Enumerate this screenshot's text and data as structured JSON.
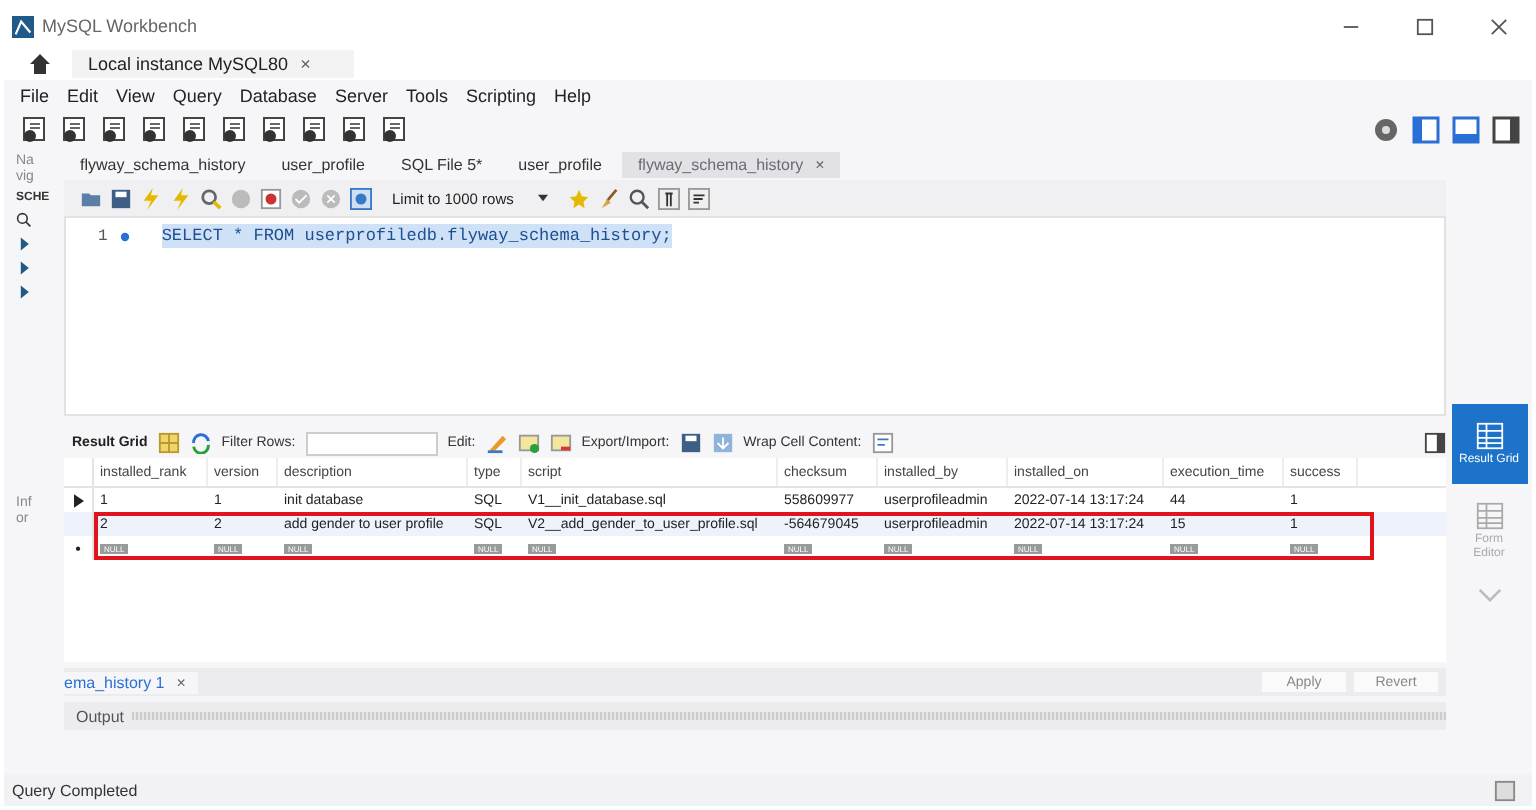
{
  "window": {
    "title": "MySQL Workbench"
  },
  "connection_tab": {
    "label": "Local instance MySQL80",
    "close": "×"
  },
  "menu": [
    "File",
    "Edit",
    "View",
    "Query",
    "Database",
    "Server",
    "Tools",
    "Scripting",
    "Help"
  ],
  "navigator": {
    "label": "Na vig",
    "schemas_label": "SCHE",
    "info_label": "Inf or"
  },
  "editor_tabs": [
    {
      "label": "flyway_schema_history",
      "selected": false
    },
    {
      "label": "user_profile",
      "selected": false
    },
    {
      "label": "SQL File 5*",
      "selected": false
    },
    {
      "label": "user_profile",
      "selected": false
    },
    {
      "label": "flyway_schema_history",
      "selected": true,
      "close": "×"
    }
  ],
  "editor_toolbar": {
    "limit": "Limit to 1000 rows"
  },
  "editor": {
    "lines": [
      {
        "number": "1",
        "text": "SELECT * FROM userprofiledb.flyway_schema_history;",
        "selected": true
      }
    ]
  },
  "result_toolbar": {
    "result_grid": "Result Grid",
    "filter_label": "Filter Rows:",
    "edit_label": "Edit:",
    "export_label": "Export/Import:",
    "wrap_label": "Wrap Cell Content:"
  },
  "table": {
    "columns": [
      "installed_rank",
      "version",
      "description",
      "type",
      "script",
      "checksum",
      "installed_by",
      "installed_on",
      "execution_time",
      "success"
    ],
    "rows": [
      {
        "current": true,
        "highlighted": false,
        "cells": [
          "1",
          "1",
          "init database",
          "SQL",
          "V1__init_database.sql",
          "558609977",
          "userprofileadmin",
          "2022-07-14 13:17:24",
          "44",
          "1"
        ]
      },
      {
        "current": false,
        "highlighted": true,
        "cells": [
          "2",
          "2",
          "add gender to user profile",
          "SQL",
          "V2__add_gender_to_user_profile.sql",
          "-564679045",
          "userprofileadmin",
          "2022-07-14 13:17:24",
          "15",
          "1"
        ]
      }
    ],
    "new_row": {
      "marker": "•",
      "cells": [
        "NULL",
        "NULL",
        "NULL",
        "NULL",
        "NULL",
        "NULL",
        "NULL",
        "NULL",
        "NULL",
        "NULL"
      ]
    }
  },
  "result_tabs": [
    {
      "label": "ema_history 1",
      "close": "×"
    }
  ],
  "buttons": [
    "Apply",
    "Revert"
  ],
  "output": {
    "label": "Output"
  },
  "side_panel": [
    {
      "label": "Result Grid",
      "selected": true
    },
    {
      "label": "Form Editor",
      "selected": false
    }
  ],
  "status_bar": "Query Completed"
}
